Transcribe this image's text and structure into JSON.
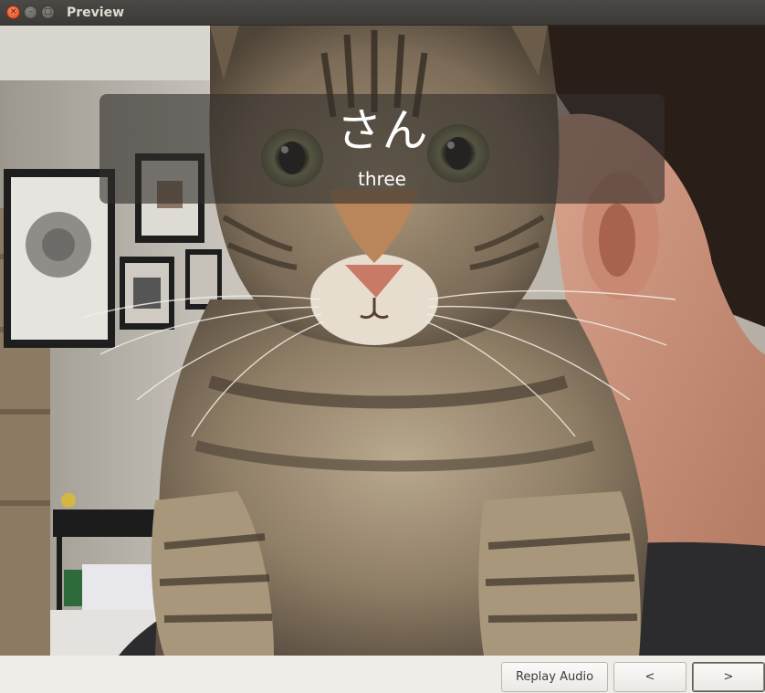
{
  "window": {
    "title": "Preview",
    "close_glyph": "×",
    "minimize_glyph": "–",
    "maximize_glyph": "□"
  },
  "card": {
    "kana": "さん",
    "meaning": "three"
  },
  "image": {
    "description": "photo-cat-on-shoulder"
  },
  "buttons": {
    "replay_label": "Replay Audio",
    "prev_label": "<",
    "next_label": ">"
  },
  "colors": {
    "titlebar": "#3b3a36",
    "close": "#e1471c",
    "overlay": "#322f2c",
    "window_bg": "#f0ede8"
  }
}
